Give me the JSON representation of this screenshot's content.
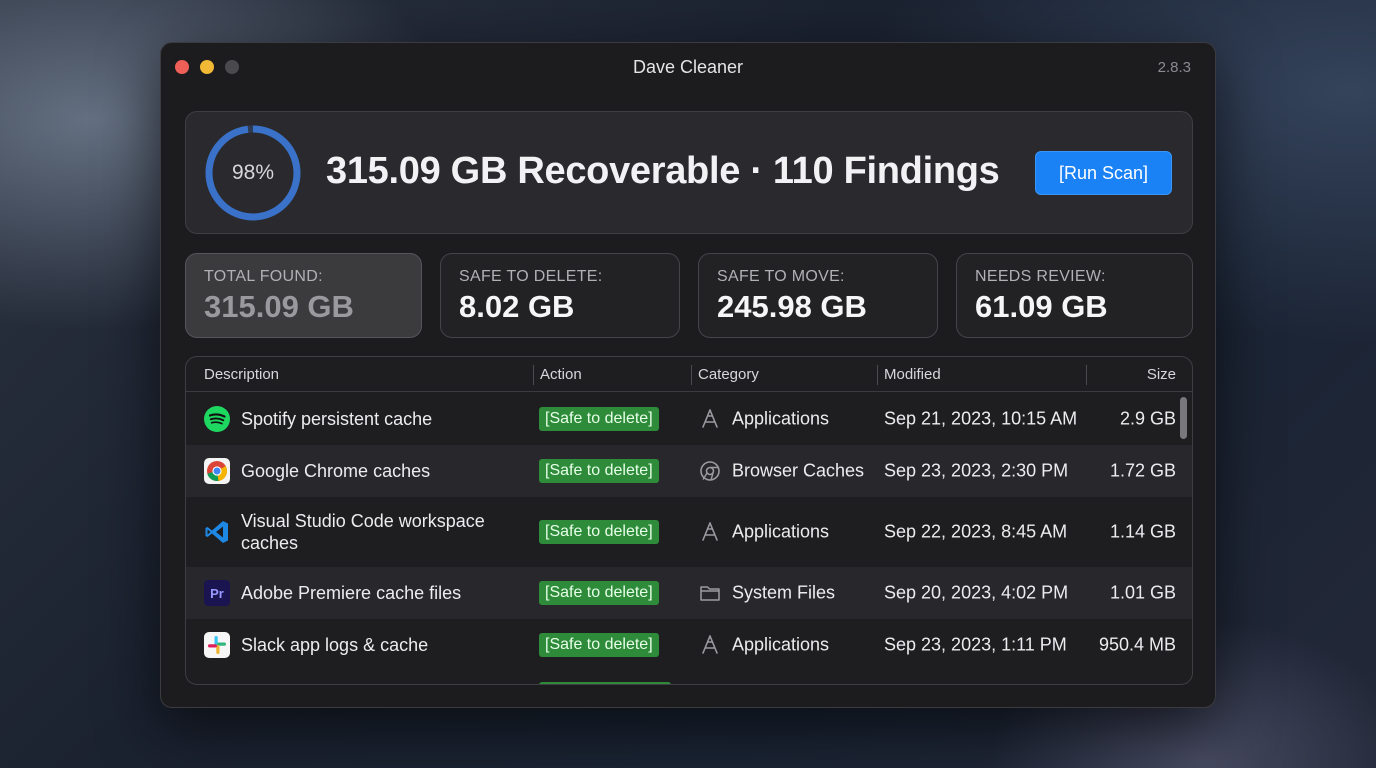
{
  "window": {
    "title": "Dave Cleaner",
    "version": "2.8.3"
  },
  "summary": {
    "progress_text": "98%",
    "progress_value": 0.98,
    "headline": "315.09 GB Recoverable · 110 Findings",
    "run_scan_label": "[Run Scan]"
  },
  "stats": [
    {
      "label": "TOTAL FOUND:",
      "value": "315.09 GB"
    },
    {
      "label": "SAFE TO DELETE:",
      "value": "8.02 GB"
    },
    {
      "label": "SAFE TO MOVE:",
      "value": "245.98 GB"
    },
    {
      "label": "NEEDS REVIEW:",
      "value": "61.09 GB"
    }
  ],
  "table": {
    "columns": [
      "Description",
      "Action",
      "Category",
      "Modified",
      "Size"
    ],
    "rows": [
      {
        "icon": "spotify-icon",
        "description": "Spotify persistent cache",
        "action": "[Safe to delete]",
        "category_icon": "applications-icon",
        "category": "Applications",
        "modified": "Sep 21, 2023, 10:15 AM",
        "size": "2.9 GB"
      },
      {
        "icon": "chrome-icon",
        "description": "Google Chrome caches",
        "action": "[Safe to delete]",
        "category_icon": "browser-icon",
        "category": "Browser Caches",
        "modified": "Sep 23, 2023, 2:30 PM",
        "size": "1.72 GB"
      },
      {
        "icon": "vscode-icon",
        "description": "Visual Studio Code workspace caches",
        "action": "[Safe to delete]",
        "category_icon": "applications-icon",
        "category": "Applications",
        "modified": "Sep 22, 2023, 8:45 AM",
        "size": "1.14 GB"
      },
      {
        "icon": "premiere-icon",
        "icon_text": "Pr",
        "description": "Adobe Premiere cache files",
        "action": "[Safe to delete]",
        "category_icon": "folder-icon",
        "category": "System Files",
        "modified": "Sep 20, 2023, 4:02 PM",
        "size": "1.01 GB"
      },
      {
        "icon": "slack-icon",
        "description": "Slack app logs & cache",
        "action": "[Safe to delete]",
        "category_icon": "applications-icon",
        "category": "Applications",
        "modified": "Sep 23, 2023, 1:11 PM",
        "size": "950.4 MB"
      }
    ]
  },
  "colors": {
    "accent": "#1a82f5",
    "safe_badge": "#2e8b3a",
    "gauge": "#3a72c9"
  }
}
